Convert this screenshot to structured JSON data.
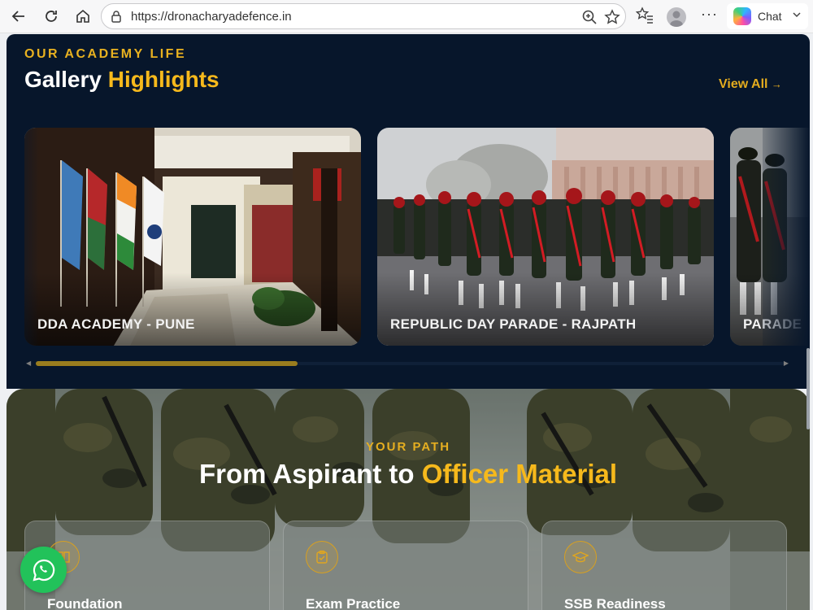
{
  "browser": {
    "url": "https://dronacharyadefence.in",
    "chat_label": "Chat",
    "icons": [
      "back-icon",
      "refresh-icon",
      "home-icon",
      "lock-icon",
      "zoom-icon",
      "star-icon",
      "favorites-icon",
      "profile-avatar",
      "more-icon",
      "copilot-icon",
      "chevron-down-icon"
    ]
  },
  "gallery": {
    "eyebrow": "OUR ACADEMY LIFE",
    "title_part1": "Gallery",
    "title_part2": "Highlights",
    "view_all": "View All",
    "view_all_arrow": "→",
    "cards": [
      {
        "caption": "DDA ACADEMY - PUNE"
      },
      {
        "caption": "REPUBLIC DAY PARADE - RAJPATH"
      },
      {
        "caption": "PARADE"
      }
    ],
    "scroll_position": 0.35
  },
  "path": {
    "eyebrow": "YOUR PATH",
    "title_part1": "From Aspirant to",
    "title_part2": "Officer Material",
    "steps": [
      {
        "label": "Foundation",
        "icon": "book-icon"
      },
      {
        "label": "Exam Practice",
        "icon": "clipboard-check-icon"
      },
      {
        "label": "SSB Readiness",
        "icon": "graduation-cap-icon"
      }
    ]
  },
  "colors": {
    "accent": "#f6b91c",
    "navy": "#07162b",
    "whatsapp": "#22c25a"
  }
}
